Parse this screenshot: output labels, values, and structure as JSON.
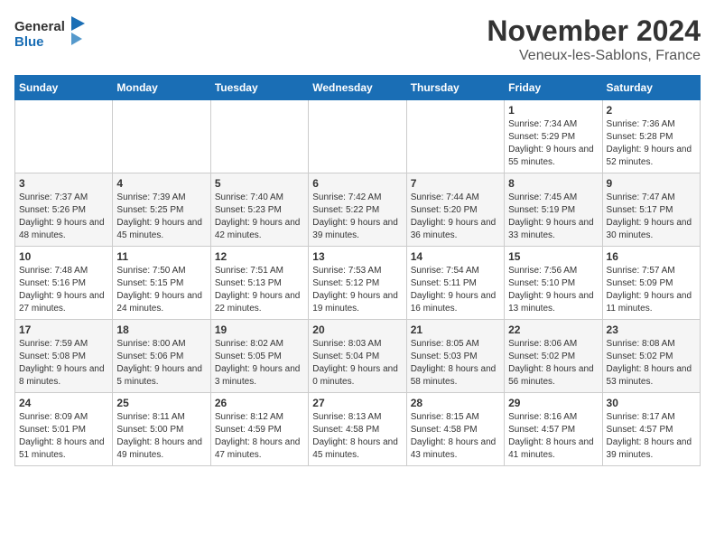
{
  "logo": {
    "line1": "General",
    "line2": "Blue"
  },
  "title": "November 2024",
  "location": "Veneux-les-Sablons, France",
  "days_of_week": [
    "Sunday",
    "Monday",
    "Tuesday",
    "Wednesday",
    "Thursday",
    "Friday",
    "Saturday"
  ],
  "weeks": [
    [
      {
        "day": "",
        "info": ""
      },
      {
        "day": "",
        "info": ""
      },
      {
        "day": "",
        "info": ""
      },
      {
        "day": "",
        "info": ""
      },
      {
        "day": "",
        "info": ""
      },
      {
        "day": "1",
        "info": "Sunrise: 7:34 AM\nSunset: 5:29 PM\nDaylight: 9 hours and 55 minutes."
      },
      {
        "day": "2",
        "info": "Sunrise: 7:36 AM\nSunset: 5:28 PM\nDaylight: 9 hours and 52 minutes."
      }
    ],
    [
      {
        "day": "3",
        "info": "Sunrise: 7:37 AM\nSunset: 5:26 PM\nDaylight: 9 hours and 48 minutes."
      },
      {
        "day": "4",
        "info": "Sunrise: 7:39 AM\nSunset: 5:25 PM\nDaylight: 9 hours and 45 minutes."
      },
      {
        "day": "5",
        "info": "Sunrise: 7:40 AM\nSunset: 5:23 PM\nDaylight: 9 hours and 42 minutes."
      },
      {
        "day": "6",
        "info": "Sunrise: 7:42 AM\nSunset: 5:22 PM\nDaylight: 9 hours and 39 minutes."
      },
      {
        "day": "7",
        "info": "Sunrise: 7:44 AM\nSunset: 5:20 PM\nDaylight: 9 hours and 36 minutes."
      },
      {
        "day": "8",
        "info": "Sunrise: 7:45 AM\nSunset: 5:19 PM\nDaylight: 9 hours and 33 minutes."
      },
      {
        "day": "9",
        "info": "Sunrise: 7:47 AM\nSunset: 5:17 PM\nDaylight: 9 hours and 30 minutes."
      }
    ],
    [
      {
        "day": "10",
        "info": "Sunrise: 7:48 AM\nSunset: 5:16 PM\nDaylight: 9 hours and 27 minutes."
      },
      {
        "day": "11",
        "info": "Sunrise: 7:50 AM\nSunset: 5:15 PM\nDaylight: 9 hours and 24 minutes."
      },
      {
        "day": "12",
        "info": "Sunrise: 7:51 AM\nSunset: 5:13 PM\nDaylight: 9 hours and 22 minutes."
      },
      {
        "day": "13",
        "info": "Sunrise: 7:53 AM\nSunset: 5:12 PM\nDaylight: 9 hours and 19 minutes."
      },
      {
        "day": "14",
        "info": "Sunrise: 7:54 AM\nSunset: 5:11 PM\nDaylight: 9 hours and 16 minutes."
      },
      {
        "day": "15",
        "info": "Sunrise: 7:56 AM\nSunset: 5:10 PM\nDaylight: 9 hours and 13 minutes."
      },
      {
        "day": "16",
        "info": "Sunrise: 7:57 AM\nSunset: 5:09 PM\nDaylight: 9 hours and 11 minutes."
      }
    ],
    [
      {
        "day": "17",
        "info": "Sunrise: 7:59 AM\nSunset: 5:08 PM\nDaylight: 9 hours and 8 minutes."
      },
      {
        "day": "18",
        "info": "Sunrise: 8:00 AM\nSunset: 5:06 PM\nDaylight: 9 hours and 5 minutes."
      },
      {
        "day": "19",
        "info": "Sunrise: 8:02 AM\nSunset: 5:05 PM\nDaylight: 9 hours and 3 minutes."
      },
      {
        "day": "20",
        "info": "Sunrise: 8:03 AM\nSunset: 5:04 PM\nDaylight: 9 hours and 0 minutes."
      },
      {
        "day": "21",
        "info": "Sunrise: 8:05 AM\nSunset: 5:03 PM\nDaylight: 8 hours and 58 minutes."
      },
      {
        "day": "22",
        "info": "Sunrise: 8:06 AM\nSunset: 5:02 PM\nDaylight: 8 hours and 56 minutes."
      },
      {
        "day": "23",
        "info": "Sunrise: 8:08 AM\nSunset: 5:02 PM\nDaylight: 8 hours and 53 minutes."
      }
    ],
    [
      {
        "day": "24",
        "info": "Sunrise: 8:09 AM\nSunset: 5:01 PM\nDaylight: 8 hours and 51 minutes."
      },
      {
        "day": "25",
        "info": "Sunrise: 8:11 AM\nSunset: 5:00 PM\nDaylight: 8 hours and 49 minutes."
      },
      {
        "day": "26",
        "info": "Sunrise: 8:12 AM\nSunset: 4:59 PM\nDaylight: 8 hours and 47 minutes."
      },
      {
        "day": "27",
        "info": "Sunrise: 8:13 AM\nSunset: 4:58 PM\nDaylight: 8 hours and 45 minutes."
      },
      {
        "day": "28",
        "info": "Sunrise: 8:15 AM\nSunset: 4:58 PM\nDaylight: 8 hours and 43 minutes."
      },
      {
        "day": "29",
        "info": "Sunrise: 8:16 AM\nSunset: 4:57 PM\nDaylight: 8 hours and 41 minutes."
      },
      {
        "day": "30",
        "info": "Sunrise: 8:17 AM\nSunset: 4:57 PM\nDaylight: 8 hours and 39 minutes."
      }
    ]
  ]
}
